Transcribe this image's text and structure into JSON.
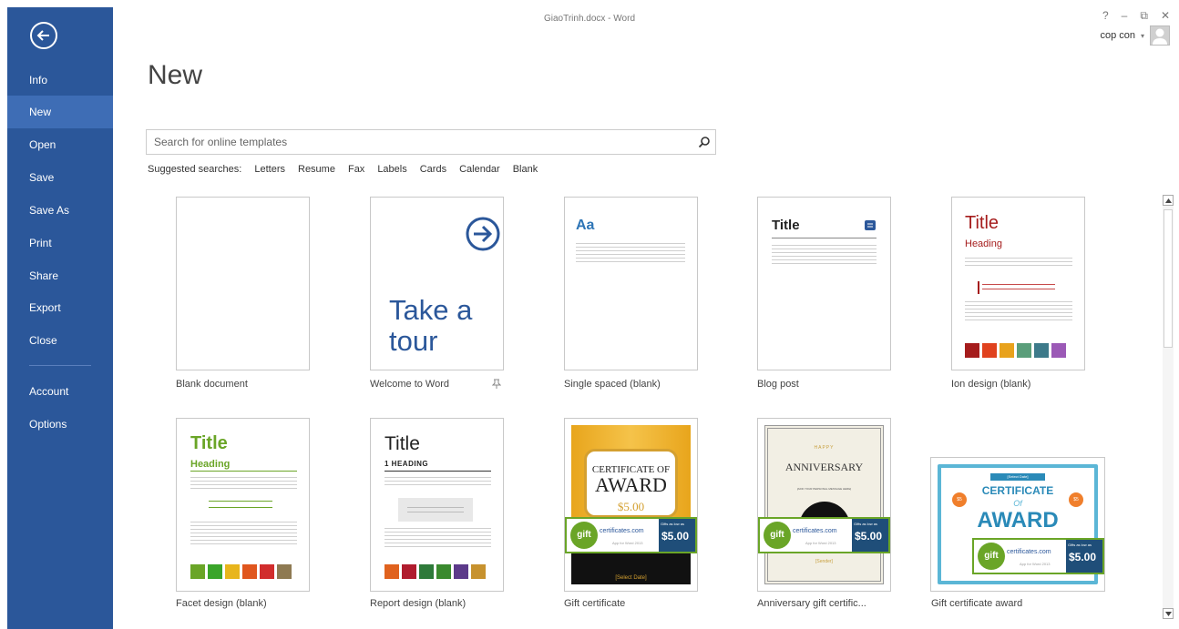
{
  "window": {
    "title": "GiaoTrinh.docx - Word",
    "help": "?",
    "minimize": "–",
    "restore": "⧉",
    "close": "✕"
  },
  "account": {
    "name": "cop con",
    "caret": "▾"
  },
  "sidebar": {
    "items": [
      {
        "label": "Info"
      },
      {
        "label": "New"
      },
      {
        "label": "Open"
      },
      {
        "label": "Save"
      },
      {
        "label": "Save As"
      },
      {
        "label": "Print"
      },
      {
        "label": "Share"
      },
      {
        "label": "Export"
      },
      {
        "label": "Close"
      },
      {
        "label": "Account"
      },
      {
        "label": "Options"
      }
    ],
    "active": "New"
  },
  "page": {
    "title": "New"
  },
  "search": {
    "placeholder": "Search for online templates"
  },
  "suggested": {
    "label": "Suggested searches:",
    "links": [
      "Letters",
      "Resume",
      "Fax",
      "Labels",
      "Cards",
      "Calendar",
      "Blank"
    ]
  },
  "templates": [
    {
      "label": "Blank document"
    },
    {
      "label": "Welcome to Word",
      "thumb_text_1": "Take a",
      "thumb_text_2": "tour"
    },
    {
      "label": "Single spaced (blank)",
      "thumb_text": "Aa"
    },
    {
      "label": "Blog post",
      "thumb_text": "Title"
    },
    {
      "label": "Ion design (blank)",
      "thumb_title": "Title",
      "thumb_heading": "Heading"
    },
    {
      "label": "Facet design (blank)",
      "thumb_title": "Title",
      "thumb_heading": "Heading"
    },
    {
      "label": "Report design (blank)",
      "thumb_title": "Title",
      "thumb_heading": "1  HEADING"
    },
    {
      "label": "Gift certificate",
      "t1": "CERTIFICATE OF",
      "t2": "AWARD",
      "t3": "$5.00",
      "t4": "[Select Date]",
      "promo_label": "certificates.com",
      "promo_price": "$5.00",
      "promo_small": "Gifts as low as",
      "promo_app": "App for Word 2013",
      "gift": "gift"
    },
    {
      "label": "Anniversary gift certific...",
      "t0": "HAPPY",
      "t1": "ANNIVERSARY",
      "t2": "[ADD YOUR PERSONAL MESSAGE HERE]",
      "t3": "[Sender]",
      "promo_label": "certificates.com",
      "promo_price": "$5.00",
      "promo_small": "Gifts as low as",
      "promo_app": "App for Word 2013",
      "gift": "gift"
    },
    {
      "label": "Gift certificate award",
      "t0": "[Select Date]",
      "t1": "CERTIFICATE",
      "t2": "Of",
      "t3": "AWARD",
      "badge": "$5",
      "promo_label": "certificates.com",
      "promo_price": "$5.00",
      "promo_small": "Gifts as low as",
      "promo_app": "App for Word 2013",
      "gift": "gift"
    }
  ],
  "colors": {
    "sidebar": "#2b579a",
    "sidebar_active": "#3e6db5",
    "word_blue": "#2b579a",
    "ion_swatches": [
      "#a51c1c",
      "#e0421e",
      "#e8a21c",
      "#5a9e7a",
      "#3d7a8a",
      "#9b59b6"
    ],
    "facet_swatches": [
      "#6aa527",
      "#3aa52a",
      "#e8b51c",
      "#e0561e",
      "#d12d2d",
      "#8e7a52"
    ],
    "report_swatches": [
      "#e0621e",
      "#b01c2e",
      "#2e7a3a",
      "#3a8a2e",
      "#5c3a8a",
      "#c7922e"
    ]
  }
}
